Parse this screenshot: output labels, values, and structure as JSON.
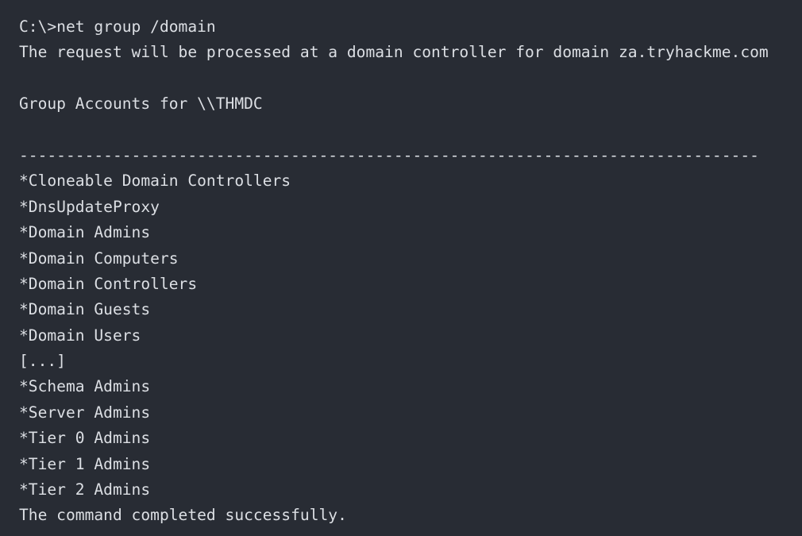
{
  "terminal": {
    "background": "#282c34",
    "text_color": "#dcdfe4",
    "lines": [
      "C:\\>net group /domain",
      "The request will be processed at a domain controller for domain za.tryhackme.com",
      "",
      "Group Accounts for \\\\THMDC",
      "",
      "-------------------------------------------------------------------------------",
      "*Cloneable Domain Controllers",
      "*DnsUpdateProxy",
      "*Domain Admins",
      "*Domain Computers",
      "*Domain Controllers",
      "*Domain Guests",
      "*Domain Users",
      "[...]",
      "*Schema Admins",
      "*Server Admins",
      "*Tier 0 Admins",
      "*Tier 1 Admins",
      "*Tier 2 Admins",
      "The command completed successfully."
    ]
  }
}
